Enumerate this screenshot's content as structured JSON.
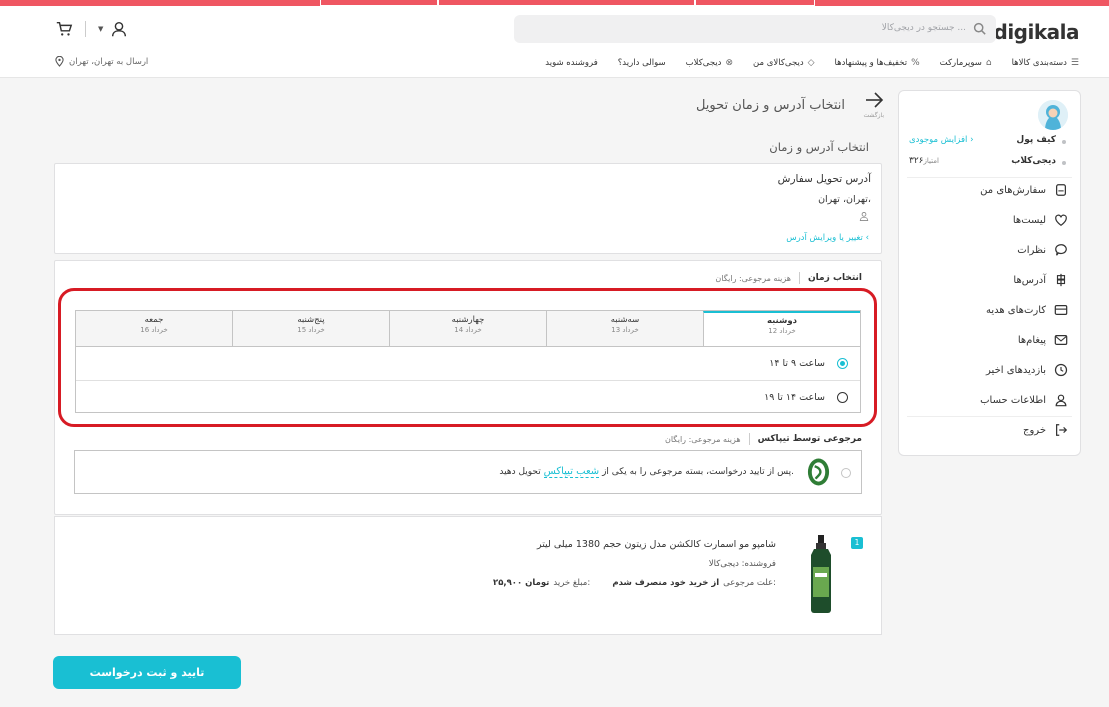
{
  "header": {
    "logo": "digikala",
    "search_placeholder": "جستجو در دیجی‌کالا ...",
    "nav": [
      {
        "label": "دسته‌بندی کالاها",
        "icon": "menu-icon"
      },
      {
        "label": "سوپرمارکت",
        "icon": "basket-icon"
      },
      {
        "label": "تخفیف‌ها و پیشنهادها",
        "icon": "discount-icon"
      },
      {
        "label": "دیجی‌کالای من",
        "icon": "bag-icon"
      },
      {
        "label": "دیجی‌کلاب",
        "icon": "club-icon"
      },
      {
        "label": "سوالی دارید؟",
        "icon": ""
      },
      {
        "label": "فروشنده شوید",
        "icon": ""
      }
    ],
    "ship_to": "ارسال به تهران، تهران"
  },
  "sidebar": {
    "wallet_label": "کیف پول",
    "wallet_action": "افزایش موجودی",
    "club_label": "دیجی‌کلاب",
    "club_points": "۳۲۶",
    "club_unit": "امتیاز",
    "menu": [
      {
        "label": "سفارش‌های من",
        "icon": "orders-icon"
      },
      {
        "label": "لیست‌ها",
        "icon": "heart-icon"
      },
      {
        "label": "نظرات",
        "icon": "comment-icon"
      },
      {
        "label": "آدرس‌ها",
        "icon": "location-icon"
      },
      {
        "label": "کارت‌های هدیه",
        "icon": "gift-card-icon"
      },
      {
        "label": "پیغام‌ها",
        "icon": "mail-icon"
      },
      {
        "label": "بازدیدهای اخیر",
        "icon": "clock-icon"
      },
      {
        "label": "اطلاعات حساب",
        "icon": "user-icon"
      },
      {
        "label": "خروج",
        "icon": "logout-icon"
      }
    ]
  },
  "page": {
    "back_label": "بازگشت",
    "title": "انتخاب آدرس و زمان تحویل",
    "subtitle": "انتخاب آدرس و زمان"
  },
  "address": {
    "title": "آدرس تحویل سفارش",
    "city": "تهران، تهران،",
    "edit": "تغییر یا ویرایش آدرس"
  },
  "time": {
    "title": "انتخاب زمان",
    "cost": "هزینه مرجوعی: رایگان",
    "days": [
      {
        "name": "دوشنبه",
        "date": "12 خرداد",
        "active": true
      },
      {
        "name": "سه‌شنبه",
        "date": "13 خرداد",
        "active": false
      },
      {
        "name": "چهارشنبه",
        "date": "14 خرداد",
        "active": false
      },
      {
        "name": "پنج‌شنبه",
        "date": "15 خرداد",
        "active": false
      },
      {
        "name": "جمعه",
        "date": "16 خرداد",
        "active": false
      }
    ],
    "slots": [
      {
        "label": "ساعت ۹ تا ۱۴",
        "selected": true
      },
      {
        "label": "ساعت ۱۴ تا ۱۹",
        "selected": false
      }
    ]
  },
  "return": {
    "title": "مرجوعی توسط تیپاکس",
    "cost": "هزینه مرجوعی: رایگان",
    "text_before": "پس از تایید درخواست، بسته مرجوعی را به یکی از",
    "link": "شعب تیپاکس",
    "text_after": "تحویل دهید."
  },
  "product": {
    "index": "1",
    "name": "شامپو مو اسمارت کالکشن مدل زیتون حجم 1380 میلی لیتر",
    "seller": "فروشنده: دیجی‌کالا",
    "reason_label": "علت مرجوعی:",
    "reason_value": "از خرید خود منصرف شدم",
    "amount_label": "مبلغ خرید:",
    "amount_value": "۲۵,۹۰۰ تومان"
  },
  "submit_label": "تایید و ثبت درخواست",
  "colors": {
    "accent": "#19bfd3",
    "brand": "#ef5662",
    "highlight": "#d71b24"
  }
}
